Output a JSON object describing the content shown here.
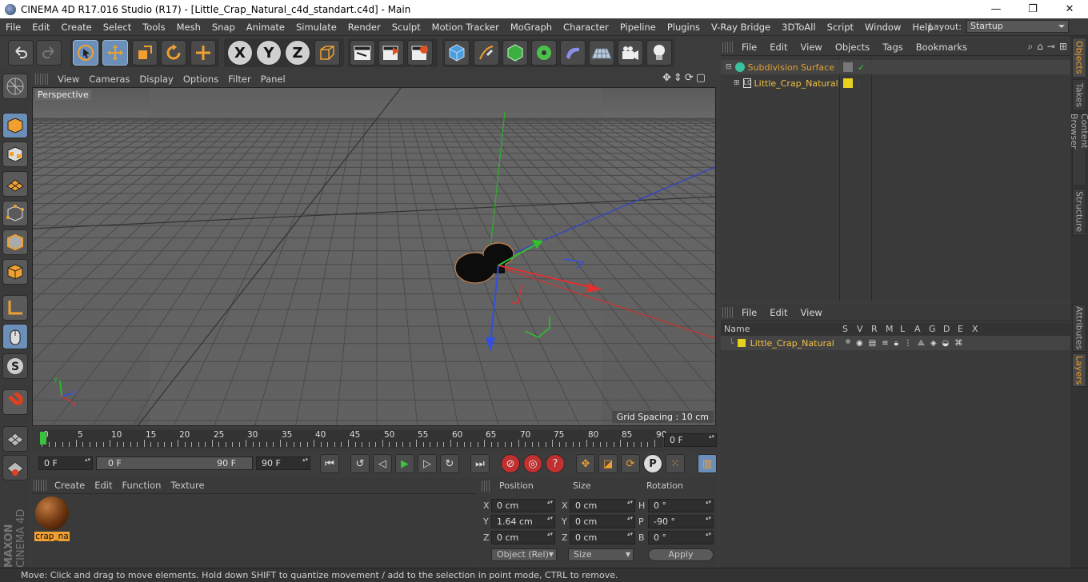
{
  "window": {
    "title": "CINEMA 4D R17.016 Studio (R17) - [Little_Crap_Natural_c4d_standart.c4d] - Main",
    "minimize": "—",
    "maximize": "❐",
    "close": "✕"
  },
  "menubar": {
    "items": [
      "File",
      "Edit",
      "Create",
      "Select",
      "Tools",
      "Mesh",
      "Snap",
      "Animate",
      "Simulate",
      "Render",
      "Sculpt",
      "Motion Tracker",
      "MoGraph",
      "Character",
      "Pipeline",
      "Plugins",
      "V-Ray Bridge",
      "3DToAll",
      "Script",
      "Window",
      "Help"
    ],
    "layout_label": "Layout:",
    "layout_value": "Startup"
  },
  "toolbar": {
    "x_label": "X",
    "y_label": "Y",
    "z_label": "Z"
  },
  "viewport": {
    "menu": [
      "View",
      "Cameras",
      "Display",
      "Options",
      "Filter",
      "Panel"
    ],
    "camera_label": "Perspective",
    "grid_spacing": "Grid Spacing : 10 cm",
    "axis_y": "y",
    "axis_z": "z",
    "axis_x": "x"
  },
  "timeline": {
    "ticks": [
      "0",
      "5",
      "10",
      "15",
      "20",
      "25",
      "30",
      "35",
      "40",
      "45",
      "50",
      "55",
      "60",
      "65",
      "70",
      "75",
      "80",
      "85",
      "90"
    ],
    "current_frame": "0 F"
  },
  "transport": {
    "start_field": "0 F",
    "range_start": "0 F",
    "range_end": "90 F",
    "end_field": "90 F",
    "p_label": "P"
  },
  "material_manager": {
    "menu": [
      "Create",
      "Edit",
      "Function",
      "Texture"
    ],
    "material_name": "crap_na"
  },
  "coordinates": {
    "headers": [
      "Position",
      "Size",
      "Rotation"
    ],
    "rows": [
      {
        "axis": "X",
        "pos": "0 cm",
        "size_axis": "X",
        "size": "0 cm",
        "rot_axis": "H",
        "rot": "0 °"
      },
      {
        "axis": "Y",
        "pos": "1.64 cm",
        "size_axis": "Y",
        "size": "0 cm",
        "rot_axis": "P",
        "rot": "-90 °"
      },
      {
        "axis": "Z",
        "pos": "0 cm",
        "size_axis": "Z",
        "size": "0 cm",
        "rot_axis": "B",
        "rot": "0 °"
      }
    ],
    "mode_select": "Object (Rel)",
    "size_select": "Size",
    "apply_label": "Apply"
  },
  "object_manager": {
    "menu": [
      "File",
      "Edit",
      "View",
      "Objects",
      "Tags",
      "Bookmarks"
    ],
    "objects": [
      {
        "name": "Subdivision Surface",
        "color": "#e0a030"
      },
      {
        "name": "Little_Crap_Natural",
        "color": "#f0c040"
      }
    ]
  },
  "layer_manager": {
    "menu": [
      "File",
      "Edit",
      "View"
    ],
    "columns": [
      "Name",
      "S",
      "V",
      "R",
      "M",
      "L",
      "A",
      "G",
      "D",
      "E",
      "X"
    ],
    "layers": [
      {
        "name": "Little_Crap_Natural",
        "color": "#e8d020"
      }
    ]
  },
  "right_tabs": [
    "Objects",
    "Takes",
    "Content Browser",
    "Structure",
    "Attributes",
    "Layers"
  ],
  "logo": {
    "brand": "MAXON",
    "product": "CINEMA 4D"
  },
  "status": "Move: Click and drag to move elements. Hold down SHIFT to quantize movement / add to the selection in point mode, CTRL to remove.",
  "colors": {
    "accent": "#f0a030",
    "selection_blue": "#6b8fb8",
    "x_axis": "#e03030",
    "y_axis": "#30c030",
    "z_axis": "#3050e0"
  }
}
